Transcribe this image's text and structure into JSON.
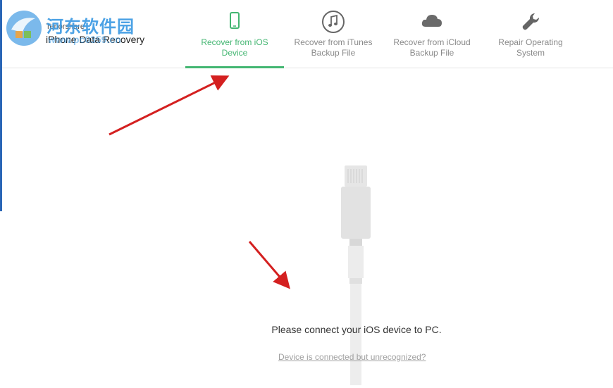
{
  "watermark": {
    "text": "河东软件园",
    "url": "www.pc0359.cn"
  },
  "brand": {
    "vendor": "Tenorshare",
    "product": "iPhone Data Recovery"
  },
  "tabs": [
    {
      "label": "Recover from iOS\nDevice",
      "icon": "phone-icon",
      "active": true
    },
    {
      "label": "Recover from iTunes\nBackup File",
      "icon": "music-note-icon",
      "active": false
    },
    {
      "label": "Recover from iCloud\nBackup File",
      "icon": "cloud-icon",
      "active": false
    },
    {
      "label": "Repair Operating\nSystem",
      "icon": "wrench-icon",
      "active": false
    }
  ],
  "main": {
    "prompt": "Please connect your iOS device to PC.",
    "help_link": "Device is connected but unrecognized?",
    "illustration": "lightning-cable-icon"
  },
  "colors": {
    "accent": "#44b672",
    "annotation_arrow": "#d42020",
    "watermark": "#3d9be3"
  }
}
